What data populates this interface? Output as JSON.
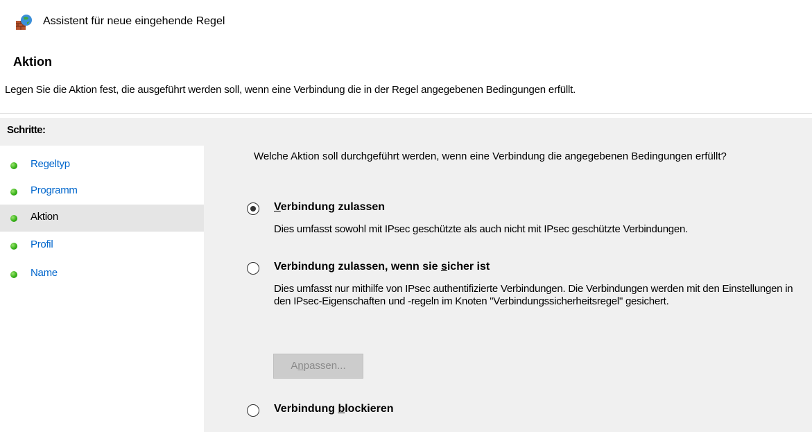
{
  "window": {
    "title": "Assistent für neue eingehende Regel",
    "icon": "firewall-icon"
  },
  "header": {
    "title": "Aktion",
    "subtitle": "Legen Sie die Aktion fest, die ausgeführt werden soll, wenn eine Verbindung die in der Regel angegebenen Bedingungen erfüllt."
  },
  "sidebar": {
    "title": "Schritte:",
    "steps": [
      {
        "label": "Regeltyp",
        "active": false
      },
      {
        "label": "Programm",
        "active": false
      },
      {
        "label": "Aktion",
        "active": true
      },
      {
        "label": "Profil",
        "active": false
      },
      {
        "label": "Name",
        "active": false
      }
    ]
  },
  "main": {
    "question": "Welche Aktion soll durchgeführt werden, wenn eine Verbindung die angegebenen Bedingungen erfüllt?",
    "options": [
      {
        "label_pre": "",
        "label_underline": "V",
        "label_post": "erbindung zulassen",
        "description": "Dies umfasst sowohl mit IPsec geschützte als auch nicht mit IPsec geschützte Verbindungen.",
        "selected": true
      },
      {
        "label_pre": "Verbindung zulassen, wenn sie ",
        "label_underline": "s",
        "label_post": "icher ist",
        "description": "Dies umfasst nur mithilfe von IPsec authentifizierte Verbindungen. Die Verbindungen werden mit den Einstellungen in den IPsec-Eigenschaften und -regeln im Knoten \"Verbindungssicherheitsregel\" gesichert.",
        "selected": false
      },
      {
        "label_pre": "Verbindung ",
        "label_underline": "b",
        "label_post": "lockieren",
        "description": "",
        "selected": false
      }
    ],
    "customize_button": {
      "pre": "A",
      "underline": "n",
      "post": "passen..."
    }
  }
}
